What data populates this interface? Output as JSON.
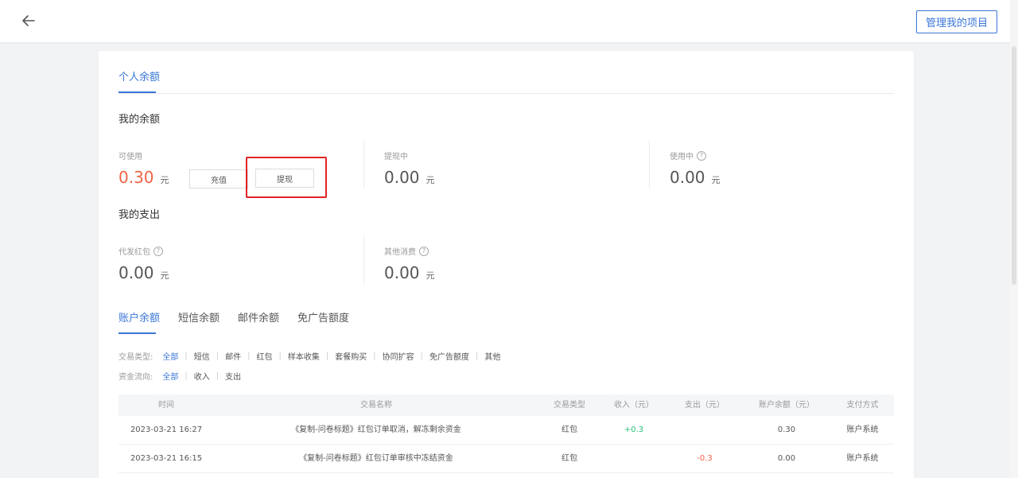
{
  "header": {
    "manage_label": "管理我的项目"
  },
  "balance_tab": "个人余额",
  "my_balance": {
    "title": "我的余额",
    "available": {
      "label": "可使用",
      "value": "0.30",
      "unit": "元"
    },
    "recharge_label": "充值",
    "withdraw_label": "提现",
    "withdrawing": {
      "label": "提现中",
      "value": "0.00",
      "unit": "元"
    },
    "in_use": {
      "label": "使用中",
      "value": "0.00",
      "unit": "元"
    }
  },
  "my_spending": {
    "title": "我的支出",
    "red_packet": {
      "label": "代发红包",
      "value": "0.00",
      "unit": "元"
    },
    "other": {
      "label": "其他消费",
      "value": "0.00",
      "unit": "元"
    }
  },
  "sub_tabs": [
    "账户余额",
    "短信余额",
    "邮件余额",
    "免广告额度"
  ],
  "filters": {
    "type_label": "交易类型:",
    "types": [
      "全部",
      "短信",
      "邮件",
      "红包",
      "样本收集",
      "套餐购买",
      "协同扩容",
      "免广告额度",
      "其他"
    ],
    "flow_label": "资金流向:",
    "flows": [
      "全部",
      "收入",
      "支出"
    ]
  },
  "table": {
    "columns": [
      "时间",
      "交易名称",
      "交易类型",
      "收入（元）",
      "支出（元）",
      "账户余额（元）",
      "支付方式"
    ],
    "rows": [
      {
        "time": "2023-03-21 16:27",
        "name": "《复制-问卷标题》红包订单取消，解冻剩余资金",
        "type": "红包",
        "income": "+0.3",
        "expense": "",
        "balance": "0.30",
        "method": "账户系统"
      },
      {
        "time": "2023-03-21 16:15",
        "name": "《复制-问卷标题》红包订单审核中冻结资金",
        "type": "红包",
        "income": "",
        "expense": "-0.3",
        "balance": "0.00",
        "method": "账户系统"
      }
    ]
  },
  "help_glyph": "?",
  "icons": {
    "back": "arrow-left-icon",
    "help": "question-circle-icon"
  },
  "colors": {
    "accent": "#3a76d8",
    "red": "#f06446",
    "green": "#2bbf7c",
    "highlight": "#e02424"
  }
}
